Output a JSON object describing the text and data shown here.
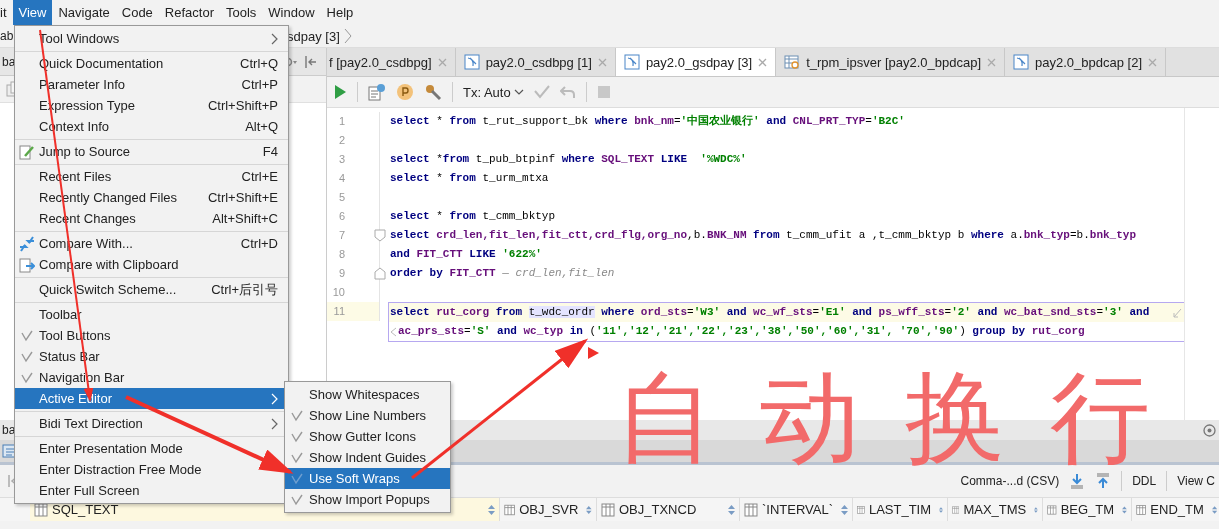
{
  "menu_bar": [
    {
      "label": "it",
      "selected": false
    },
    {
      "label": "View",
      "selected": true
    },
    {
      "label": "Navigate",
      "selected": false
    },
    {
      "label": "Code",
      "selected": false
    },
    {
      "label": "Refactor",
      "selected": false
    },
    {
      "label": "Tools",
      "selected": false
    },
    {
      "label": "Window",
      "selected": false
    },
    {
      "label": "Help",
      "selected": false
    }
  ],
  "navigation_bar": {
    "left": "ab",
    "crumb": "sdpay [3]"
  },
  "left_panel": {
    "tab": "ba"
  },
  "editor_tabs": [
    {
      "label": "f [pay2.0_csdbpg]",
      "selected": false,
      "kind": "partial"
    },
    {
      "label": "pay2.0_csdbpg [1]",
      "selected": false,
      "kind": "console"
    },
    {
      "label": "pay2.0_gsdpay [3]",
      "selected": true,
      "kind": "console"
    },
    {
      "label": "t_rpm_ipsver [pay2.0_bpdcap]",
      "selected": false,
      "kind": "table"
    },
    {
      "label": "pay2.0_bpdcap [2]",
      "selected": false,
      "kind": "console"
    }
  ],
  "editor_toolbar": {
    "tx_mode": "Tx: Auto"
  },
  "code_lines": [
    {
      "number": "1",
      "current": false,
      "tokens": [
        {
          "text": "select",
          "kind": "keyword"
        },
        {
          "text": " *",
          "kind": "plain"
        },
        {
          "text": " from",
          "kind": "keyword"
        },
        {
          "text": " t_rut_support_bk",
          "kind": "plain"
        },
        {
          "text": " where",
          "kind": "keyword"
        },
        {
          "text": " bnk_nm",
          "kind": "column"
        },
        {
          "text": "=",
          "kind": "plain"
        },
        {
          "text": "'中国农业银行'",
          "kind": "string"
        },
        {
          "text": " and",
          "kind": "keyword"
        },
        {
          "text": " CNL_PRT_TYP",
          "kind": "column"
        },
        {
          "text": "=",
          "kind": "plain"
        },
        {
          "text": "'B2C'",
          "kind": "string"
        }
      ]
    },
    {
      "number": "2",
      "current": false
    },
    {
      "number": "3",
      "current": false,
      "tokens": [
        {
          "text": "select",
          "kind": "keyword"
        },
        {
          "text": " *",
          "kind": "plain"
        },
        {
          "text": "from",
          "kind": "keyword"
        },
        {
          "text": " t_pub_btpinf",
          "kind": "plain"
        },
        {
          "text": " where",
          "kind": "keyword"
        },
        {
          "text": " SQL_TEXT",
          "kind": "column"
        },
        {
          "text": " LIKE",
          "kind": "keyword"
        },
        {
          "text": "  '%WDC%'",
          "kind": "string"
        }
      ]
    },
    {
      "number": "4",
      "current": false,
      "tokens": [
        {
          "text": "select",
          "kind": "keyword"
        },
        {
          "text": " *",
          "kind": "plain"
        },
        {
          "text": " from",
          "kind": "keyword"
        },
        {
          "text": " t_urm_mtxa",
          "kind": "plain"
        }
      ]
    },
    {
      "number": "5",
      "current": false
    },
    {
      "number": "6",
      "current": false,
      "tokens": [
        {
          "text": "select",
          "kind": "keyword"
        },
        {
          "text": " *",
          "kind": "plain"
        },
        {
          "text": " from",
          "kind": "keyword"
        },
        {
          "text": " t_cmm_bktyp",
          "kind": "plain"
        }
      ]
    },
    {
      "number": "7",
      "current": false,
      "kind": "opener",
      "tokens": [
        {
          "text": "select",
          "kind": "keyword"
        },
        {
          "text": " crd_len,fit_len,fit_ctt,crd_flg,org_no",
          "kind": "column"
        },
        {
          "text": ",b.",
          "kind": "plain"
        },
        {
          "text": "BNK_NM",
          "kind": "column"
        },
        {
          "text": " from",
          "kind": "keyword"
        },
        {
          "text": " t_cmm_ufit a ,t_cmm_bktyp b",
          "kind": "plain"
        },
        {
          "text": " where",
          "kind": "keyword"
        },
        {
          "text": " a.",
          "kind": "plain"
        },
        {
          "text": "bnk_typ",
          "kind": "column"
        },
        {
          "text": "=b.",
          "kind": "plain"
        },
        {
          "text": "bnk_typ",
          "kind": "column"
        }
      ]
    },
    {
      "number": "8",
      "current": false,
      "tokens": [
        {
          "text": "and",
          "kind": "keyword"
        },
        {
          "text": " FIT_CTT",
          "kind": "column"
        },
        {
          "text": " LIKE",
          "kind": "keyword"
        },
        {
          "text": " '622%'",
          "kind": "string"
        }
      ]
    },
    {
      "number": "9",
      "current": false,
      "kind": "closer",
      "tokens": [
        {
          "text": "order by",
          "kind": "keyword"
        },
        {
          "text": " FIT_CTT",
          "kind": "column"
        },
        {
          "text": " — crd_len,fit_len",
          "kind": "hint"
        }
      ]
    },
    {
      "number": "10",
      "current": false
    },
    {
      "number": "11",
      "current": true,
      "tokens": [
        {
          "text": "select",
          "kind": "keyword"
        },
        {
          "text": " rut_corg",
          "kind": "column"
        },
        {
          "text": " from ",
          "kind": "keyword"
        },
        {
          "text": "t_wdc_ordr",
          "kind": "reference"
        },
        {
          "text": " where",
          "kind": "keyword"
        },
        {
          "text": " ord_sts",
          "kind": "column"
        },
        {
          "text": "=",
          "kind": "plain"
        },
        {
          "text": "'W3'",
          "kind": "string"
        },
        {
          "text": " and",
          "kind": "keyword"
        },
        {
          "text": " wc_wf_sts",
          "kind": "column"
        },
        {
          "text": "=",
          "kind": "plain"
        },
        {
          "text": "'E1'",
          "kind": "string"
        },
        {
          "text": " and",
          "kind": "keyword"
        },
        {
          "text": " ps_wff_sts",
          "kind": "column"
        },
        {
          "text": "=",
          "kind": "plain"
        },
        {
          "text": "'2'",
          "kind": "string"
        },
        {
          "text": " and",
          "kind": "keyword"
        },
        {
          "text": " wc_bat_snd_sts",
          "kind": "column"
        },
        {
          "text": "=",
          "kind": "plain"
        },
        {
          "text": "'3'",
          "kind": "string"
        },
        {
          "text": " and",
          "kind": "keyword"
        }
      ],
      "wrapped_tokens": [
        {
          "text": "ac_prs_sts",
          "kind": "column"
        },
        {
          "text": "=",
          "kind": "plain"
        },
        {
          "text": "'S'",
          "kind": "string"
        },
        {
          "text": " and",
          "kind": "keyword"
        },
        {
          "text": " wc_typ",
          "kind": "column"
        },
        {
          "text": " in",
          "kind": "keyword"
        },
        {
          "text": " (",
          "kind": "plain"
        },
        {
          "text": "'11','12','21','22','23','38','50','60','31', '70','90'",
          "kind": "string"
        },
        {
          "text": ")",
          "kind": "plain"
        },
        {
          "text": " group by",
          "kind": "keyword"
        },
        {
          "text": " rut_corg",
          "kind": "column"
        }
      ]
    }
  ],
  "view_menu": {
    "items": [
      {
        "kind": "item",
        "label": "Tool Windows",
        "submenu": true,
        "selected": false,
        "checked": false
      },
      {
        "kind": "separator"
      },
      {
        "kind": "item",
        "label": "Quick Documentation",
        "shortcut": "Ctrl+Q",
        "submenu": false,
        "selected": false,
        "checked": false
      },
      {
        "kind": "item",
        "label": "Parameter Info",
        "shortcut": "Ctrl+P",
        "submenu": false,
        "selected": false,
        "checked": false
      },
      {
        "kind": "item",
        "label": "Expression Type",
        "shortcut": "Ctrl+Shift+P",
        "submenu": false,
        "selected": false,
        "checked": false
      },
      {
        "kind": "item",
        "label": "Context Info",
        "shortcut": "Alt+Q",
        "submenu": false,
        "selected": false,
        "checked": false
      },
      {
        "kind": "separator"
      },
      {
        "kind": "source",
        "label": "Jump to Source",
        "shortcut": "F4",
        "submenu": false,
        "selected": false,
        "checked": false
      },
      {
        "kind": "separator"
      },
      {
        "kind": "item",
        "label": "Recent Files",
        "shortcut": "Ctrl+E",
        "submenu": false,
        "selected": false,
        "checked": false
      },
      {
        "kind": "item",
        "label": "Recently Changed Files",
        "shortcut": "Ctrl+Shift+E",
        "submenu": false,
        "selected": false,
        "checked": false
      },
      {
        "kind": "item",
        "label": "Recent Changes",
        "shortcut": "Alt+Shift+C",
        "submenu": false,
        "selected": false,
        "checked": false
      },
      {
        "kind": "separator"
      },
      {
        "kind": "compare",
        "label": "Compare With...",
        "shortcut": "Ctrl+D",
        "submenu": false,
        "selected": false,
        "checked": false
      },
      {
        "kind": "clipboard",
        "label": "Compare with Clipboard",
        "submenu": false,
        "selected": false,
        "checked": false
      },
      {
        "kind": "separator"
      },
      {
        "kind": "item",
        "label": "Quick Switch Scheme...",
        "shortcut": "Ctrl+后引号",
        "submenu": false,
        "selected": false,
        "checked": false
      },
      {
        "kind": "separator"
      },
      {
        "kind": "item",
        "label": "Toolbar",
        "submenu": false,
        "selected": false,
        "checked": false
      },
      {
        "kind": "item",
        "label": "Tool Buttons",
        "submenu": false,
        "selected": false,
        "checked": true
      },
      {
        "kind": "item",
        "label": "Status Bar",
        "submenu": false,
        "selected": false,
        "checked": true
      },
      {
        "kind": "item",
        "label": "Navigation Bar",
        "submenu": false,
        "selected": false,
        "checked": true
      },
      {
        "kind": "item",
        "label": "Active Editor",
        "submenu": true,
        "selected": true,
        "checked": false
      },
      {
        "kind": "separator"
      },
      {
        "kind": "item",
        "label": "Bidi Text Direction",
        "submenu": true,
        "selected": false,
        "checked": false
      },
      {
        "kind": "separator"
      },
      {
        "kind": "item",
        "label": "Enter Presentation Mode",
        "submenu": false,
        "selected": false,
        "checked": false
      },
      {
        "kind": "item",
        "label": "Enter Distraction Free Mode",
        "submenu": false,
        "selected": false,
        "checked": false
      },
      {
        "kind": "item",
        "label": "Enter Full Screen",
        "submenu": false,
        "selected": false,
        "checked": false
      }
    ]
  },
  "active_editor_submenu": {
    "items": [
      {
        "label": "Show Whitespaces",
        "selected": false,
        "checked": false
      },
      {
        "label": "Show Line Numbers",
        "selected": false,
        "checked": true
      },
      {
        "label": "Show Gutter Icons",
        "selected": false,
        "checked": true
      },
      {
        "label": "Show Indent Guides",
        "selected": false,
        "checked": true
      },
      {
        "label": "Use Soft Wraps",
        "selected": true,
        "checked": true
      },
      {
        "label": "Show Import Popups",
        "selected": false,
        "checked": true
      }
    ]
  },
  "bottom_panel": {
    "tab": "ba",
    "export_format": "Comma-...d (CSV)",
    "ddl": "DDL",
    "view": "View C",
    "columns": [
      "SQL_TEXT",
      "OBJ_SVR",
      "OBJ_TXNCD",
      "`INTERVAL`",
      "LAST_TIM",
      "MAX_TMS",
      "BEG_TM",
      "END_TM"
    ]
  },
  "annotation": {
    "text": "自动换行"
  }
}
